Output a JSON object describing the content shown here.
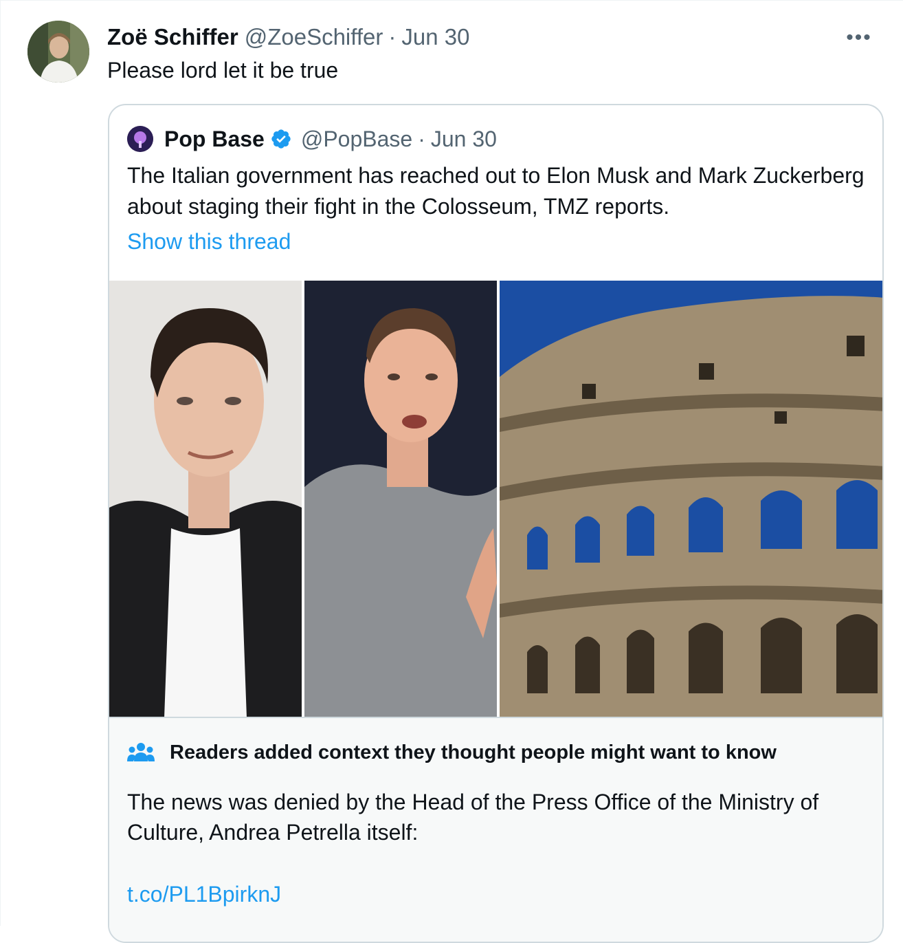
{
  "tweet": {
    "author_name": "Zoë Schiffer",
    "handle": "@ZoeSchiffer",
    "separator": "·",
    "date": "Jun 30",
    "text": "Please lord let it be true",
    "more_label": "•••"
  },
  "quoted": {
    "author_name": "Pop Base",
    "handle": "@PopBase",
    "separator": "·",
    "date": "Jun 30",
    "text": "The Italian government has reached out to Elon Musk and Mark Zuckerberg about staging their fight in the Colosseum, TMZ reports.",
    "show_thread": "Show this thread"
  },
  "note": {
    "heading": "Readers added context they thought people might want to know",
    "body": "The news was denied by the Head of the Press Office of the Ministry of Culture, Andrea Petrella itself:",
    "link": "t.co/PL1BpirknJ"
  },
  "colors": {
    "link": "#1d9bf0",
    "muted": "#536471",
    "border": "#cfd9de",
    "note_bg": "#f7f9f9",
    "verified": "#1d9bf0"
  }
}
